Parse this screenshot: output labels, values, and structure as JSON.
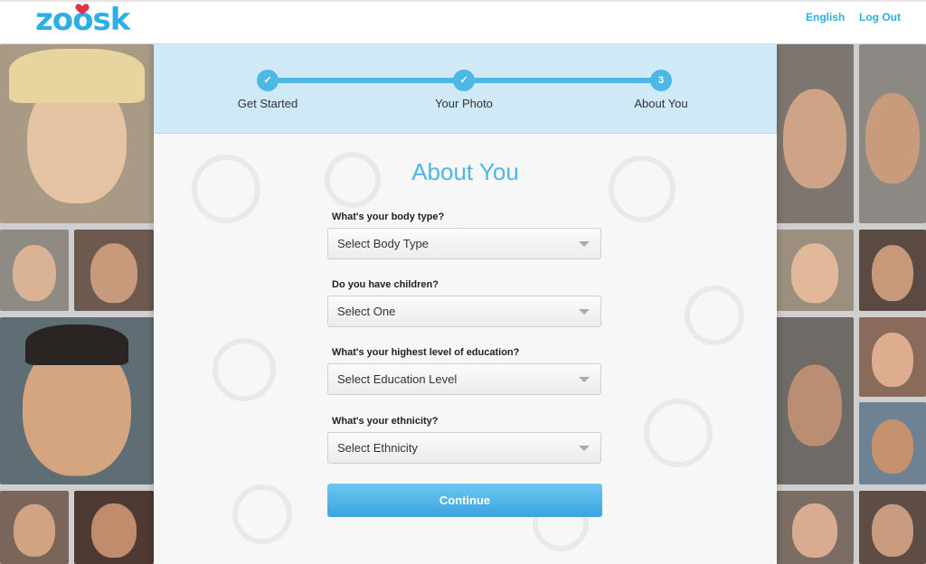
{
  "header": {
    "logo": "zoosk",
    "language_link": "English",
    "logout_link": "Log Out"
  },
  "progress": {
    "steps": [
      {
        "label": "Get Started",
        "status": "complete",
        "marker": "✓"
      },
      {
        "label": "Your Photo",
        "status": "complete",
        "marker": "✓"
      },
      {
        "label": "About You",
        "status": "current",
        "marker": "3"
      }
    ]
  },
  "form": {
    "title": "About You",
    "questions": [
      {
        "label": "What's your body type?",
        "selected": "Select Body Type"
      },
      {
        "label": "Do you have children?",
        "selected": "Select One"
      },
      {
        "label": "What's your highest level of education?",
        "selected": "Select Education Level"
      },
      {
        "label": "What's your ethnicity?",
        "selected": "Select Ethnicity"
      }
    ],
    "continue_label": "Continue"
  },
  "colors": {
    "brand": "#2eaee6",
    "accent": "#4db8e6",
    "step_band": "#cfe9f6"
  }
}
